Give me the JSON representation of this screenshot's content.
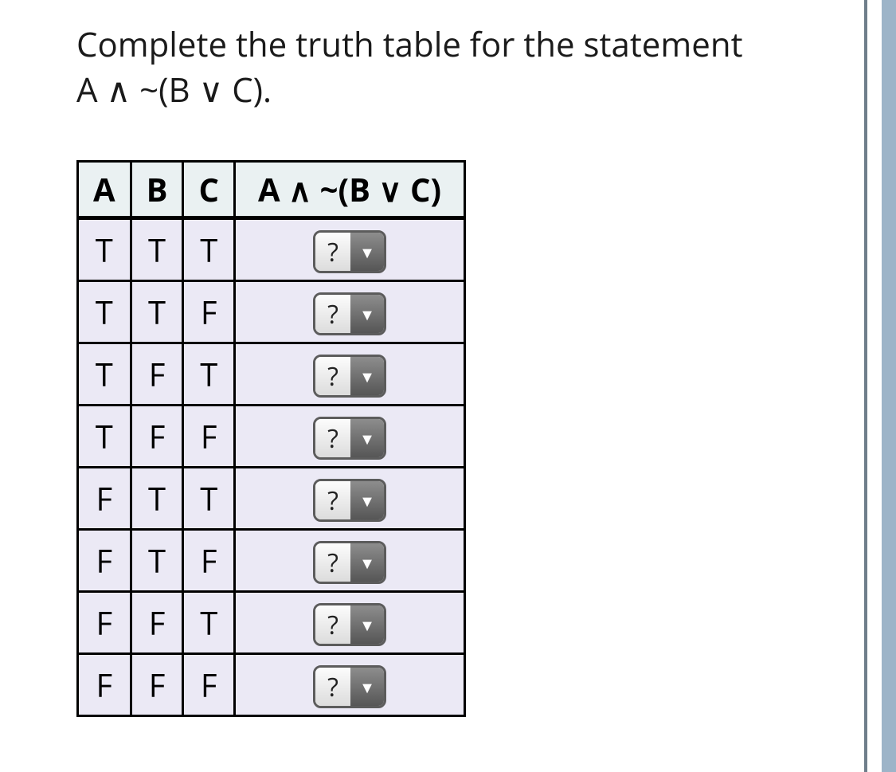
{
  "question": {
    "line1": "Complete the truth table for the statement",
    "line2": "A ∧ ~(B ∨ C)."
  },
  "table": {
    "headers": {
      "a": "A",
      "b": "B",
      "c": "C",
      "expr": "A ∧ ~(B ∨ C)"
    },
    "rows": [
      {
        "a": "T",
        "b": "T",
        "c": "T",
        "answer": "?"
      },
      {
        "a": "T",
        "b": "T",
        "c": "F",
        "answer": "?"
      },
      {
        "a": "T",
        "b": "F",
        "c": "T",
        "answer": "?"
      },
      {
        "a": "T",
        "b": "F",
        "c": "F",
        "answer": "?"
      },
      {
        "a": "F",
        "b": "T",
        "c": "T",
        "answer": "?"
      },
      {
        "a": "F",
        "b": "T",
        "c": "F",
        "answer": "?"
      },
      {
        "a": "F",
        "b": "F",
        "c": "T",
        "answer": "?"
      },
      {
        "a": "F",
        "b": "F",
        "c": "F",
        "answer": "?"
      }
    ]
  },
  "dropdown_arrow": "▼"
}
